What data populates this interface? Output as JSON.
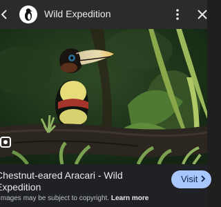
{
  "header": {
    "title": "Wild Expedition",
    "back_icon": "chevron-left-icon",
    "more_icon": "more-vert-icon",
    "close_icon": "close-icon",
    "avatar_icon": "penguin-logo"
  },
  "image": {
    "alt": "Chestnut-eared Aracari - Wild Expedition",
    "lens_icon": "lens-icon"
  },
  "result": {
    "title": "Chestnut-eared Aracari - Wild Expedition",
    "visit_label": "Visit",
    "visit_icon": "chevron-right-icon",
    "notice_text": "Images may be subject to copyright.",
    "learn_more_label": "Learn more"
  },
  "colors": {
    "header_bg": "#2b2b2b",
    "panel_bg": "#202124",
    "visit_bg": "#a8c7fa",
    "visit_text": "#0b1e46"
  }
}
